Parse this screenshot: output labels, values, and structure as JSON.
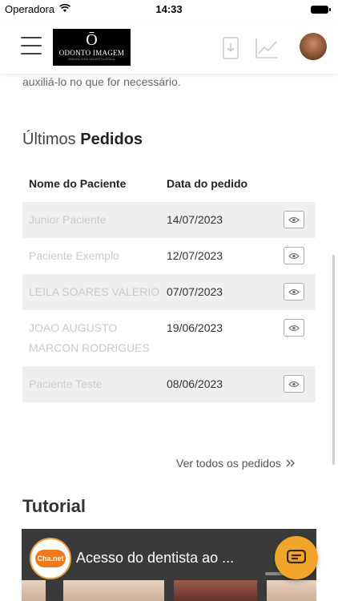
{
  "status_bar": {
    "carrier": "Operadora",
    "time": "14:33"
  },
  "header": {
    "logo_mark": "Ō",
    "logo_text": "ODONTO IMAGEM",
    "logo_sub": "RADIOLOGIA ODONTOLÓGICA"
  },
  "intro": {
    "text": "auxiliá-lo no que for necessário."
  },
  "orders": {
    "title_prefix": "Últimos",
    "title_bold": "Pedidos",
    "col_name": "Nome do Paciente",
    "col_date": "Data do pedido",
    "rows": [
      {
        "patient": "Junior Paciente",
        "date": "14/07/2023"
      },
      {
        "patient": "Paciente Exemplo",
        "date": "12/07/2023"
      },
      {
        "patient": "LEILA SOARES VALERIO",
        "date": "07/07/2023"
      },
      {
        "patient": "JOAO AUGUSTO MARCON RODRIGUES",
        "date": "19/06/2023"
      },
      {
        "patient": "Paciente Teste",
        "date": "08/06/2023"
      }
    ],
    "view_all": "Ver todos os pedidos"
  },
  "tutorial": {
    "title": "Tutorial",
    "video_title": "Acesso do dentista ao ...",
    "channel": "Cha.net"
  },
  "colors": {
    "accent": "#f2a52b",
    "row_shade": "#efefef"
  }
}
